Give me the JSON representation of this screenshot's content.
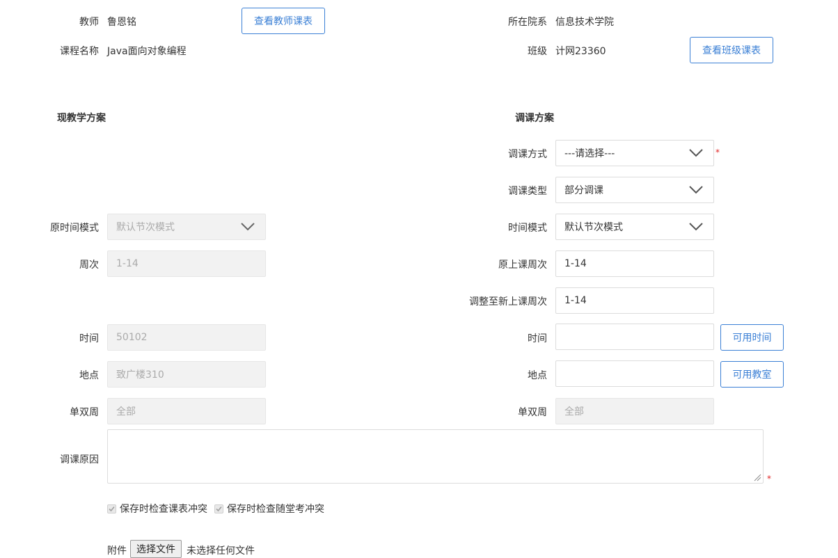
{
  "header": {
    "teacher_label": "教师",
    "teacher_value": "鲁恩铭",
    "view_teacher_btn": "查看教师课表",
    "college_label": "所在院系",
    "college_value": "信息技术学院",
    "course_label": "课程名称",
    "course_value": "Java面向对象编程",
    "class_label": "班级",
    "class_value": "计网23360",
    "view_class_btn": "查看班级课表"
  },
  "sections": {
    "current": "现教学方案",
    "adjust": "调课方案"
  },
  "current_plan": {
    "time_mode_label": "原时间模式",
    "time_mode_value": "默认节次模式",
    "weeks_label": "周次",
    "weeks_value": "1-14",
    "time_label": "时间",
    "time_value": "50102",
    "place_label": "地点",
    "place_value": "致广楼310",
    "oddeven_label": "单双周",
    "oddeven_value": "全部"
  },
  "adjust_plan": {
    "method_label": "调课方式",
    "method_value": "---请选择---",
    "type_label": "调课类型",
    "type_value": "部分调课",
    "time_mode_label": "时间模式",
    "time_mode_value": "默认节次模式",
    "orig_weeks_label": "原上课周次",
    "orig_weeks_value": "1-14",
    "new_weeks_label": "调整至新上课周次",
    "new_weeks_value": "1-14",
    "time_label": "时间",
    "time_value": "",
    "available_time_btn": "可用时间",
    "place_label": "地点",
    "place_value": "",
    "available_room_btn": "可用教室",
    "oddeven_label": "单双周",
    "oddeven_value": "全部"
  },
  "reason": {
    "label": "调课原因",
    "value": ""
  },
  "checks": {
    "schedule_conflict": "保存时检查课表冲突",
    "quiz_conflict": "保存时检查随堂考冲突"
  },
  "attachment": {
    "label": "附件",
    "choose_btn": "选择文件",
    "status": "未选择任何文件"
  },
  "required_mark": "*",
  "colors": {
    "accent": "#3a7fd5",
    "required": "#e02424",
    "disabled_bg": "#f2f2f2"
  }
}
